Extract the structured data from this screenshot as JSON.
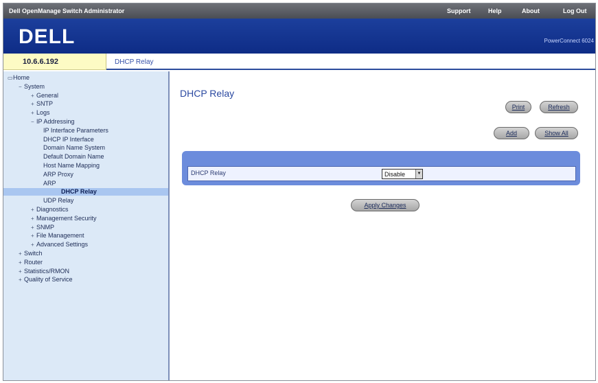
{
  "app_title": "Dell OpenManage Switch Administrator",
  "top_links": [
    "Support",
    "Help",
    "About",
    "Log Out"
  ],
  "brand": {
    "logo_text": "DELL",
    "model": "PowerConnect 6024"
  },
  "device_ip": "10.6.6.192",
  "breadcrumb": "DHCP Relay",
  "tree": [
    {
      "label": "Home",
      "exp": "",
      "expanded": true
    },
    {
      "label": "System",
      "exp": "−"
    },
    {
      "label": "General",
      "exp": "+"
    },
    {
      "label": "SNTP",
      "exp": "+"
    },
    {
      "label": "Logs",
      "exp": "+"
    },
    {
      "label": "IP Addressing",
      "exp": "−"
    },
    {
      "label": "IP Interface Parameters",
      "exp": ""
    },
    {
      "label": "DHCP IP Interface",
      "exp": ""
    },
    {
      "label": "Domain Name System",
      "exp": ""
    },
    {
      "label": "Default Domain Name",
      "exp": ""
    },
    {
      "label": "Host Name Mapping",
      "exp": ""
    },
    {
      "label": "ARP Proxy",
      "exp": ""
    },
    {
      "label": "ARP",
      "exp": ""
    },
    {
      "label": "DHCP Relay",
      "exp": "",
      "selected": true
    },
    {
      "label": "UDP Relay",
      "exp": ""
    },
    {
      "label": "Diagnostics",
      "exp": "+"
    },
    {
      "label": "Management Security",
      "exp": "+"
    },
    {
      "label": "SNMP",
      "exp": "+"
    },
    {
      "label": "File Management",
      "exp": "+"
    },
    {
      "label": "Advanced Settings",
      "exp": "+"
    },
    {
      "label": "Switch",
      "exp": "+"
    },
    {
      "label": "Router",
      "exp": "+"
    },
    {
      "label": "Statistics/RMON",
      "exp": "+"
    },
    {
      "label": "Quality of Service",
      "exp": "+"
    }
  ],
  "page": {
    "title": "DHCP Relay",
    "buttons": {
      "print": "Print",
      "refresh": "Refresh",
      "add": "Add",
      "show_all": "Show All",
      "apply": "Apply Changes"
    },
    "field_label": "DHCP Relay",
    "select_value": "Disable"
  },
  "colors": {
    "banner": "#0e2c86",
    "sidebar": "#dce9f7",
    "panel": "#6c8cdc",
    "address_bg": "#fdfbc4"
  }
}
